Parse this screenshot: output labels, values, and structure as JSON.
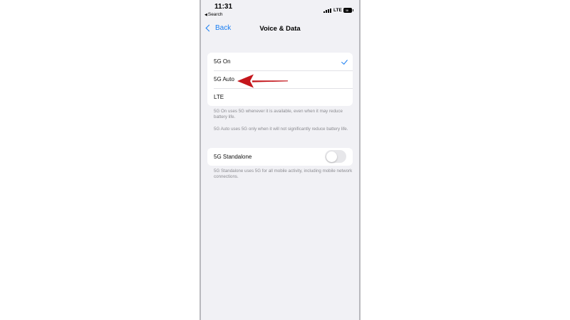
{
  "status_bar": {
    "time": "11:31",
    "back_app": "Search",
    "network": "LTE",
    "battery": "38"
  },
  "nav": {
    "back_label": "Back",
    "title": "Voice & Data"
  },
  "voice_data": {
    "options": [
      {
        "label": "5G On",
        "selected": true
      },
      {
        "label": "5G Auto",
        "selected": false
      },
      {
        "label": "LTE",
        "selected": false
      }
    ],
    "footnote_5g_on": "5G On uses 5G whenever it is available, even when it may reduce battery life.",
    "footnote_5g_auto": "5G Auto uses 5G only when it will not significantly reduce battery life."
  },
  "standalone": {
    "label": "5G Standalone",
    "enabled": false,
    "footnote": "5G Standalone uses 5G for all mobile activity, including mobile network connections."
  },
  "colors": {
    "accent": "#1a7ef2",
    "annotation_arrow": "#c4161c",
    "background": "#f1f1f5"
  }
}
